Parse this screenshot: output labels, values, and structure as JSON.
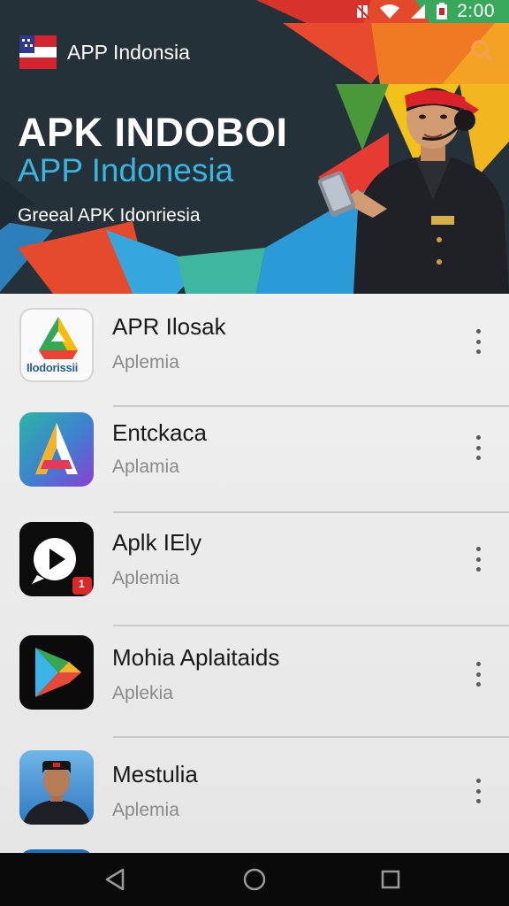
{
  "status_bar": {
    "time": "2:00"
  },
  "app_bar": {
    "title": "APP Indonsia"
  },
  "banner": {
    "title": "APK INDOBOI",
    "subtitle": "APP Indonesia",
    "tagline": "Greeal APK Idonriesia"
  },
  "apps": [
    {
      "name": "APR Ilosak",
      "subtitle": "Aplemia",
      "icon_label": "Ilodorissii",
      "icon": "triangle-logo-icon"
    },
    {
      "name": "Entckaca",
      "subtitle": "Aplamia",
      "icon": "letter-a-logo-icon"
    },
    {
      "name": "Aplk IEly",
      "subtitle": "Aplemia",
      "icon": "video-play-icon",
      "badge": "1"
    },
    {
      "name": "Mohia Aplaitaids",
      "subtitle": "Aplekia",
      "icon": "play-store-icon"
    },
    {
      "name": "Mestulia",
      "subtitle": "Aplemia",
      "icon": "person-photo-icon"
    }
  ],
  "colors": {
    "accent_orange": "#f26d21",
    "subtitle_blue": "#38b6e0",
    "nav_bar": "#0a0a0a",
    "list_background": "#ececec"
  }
}
